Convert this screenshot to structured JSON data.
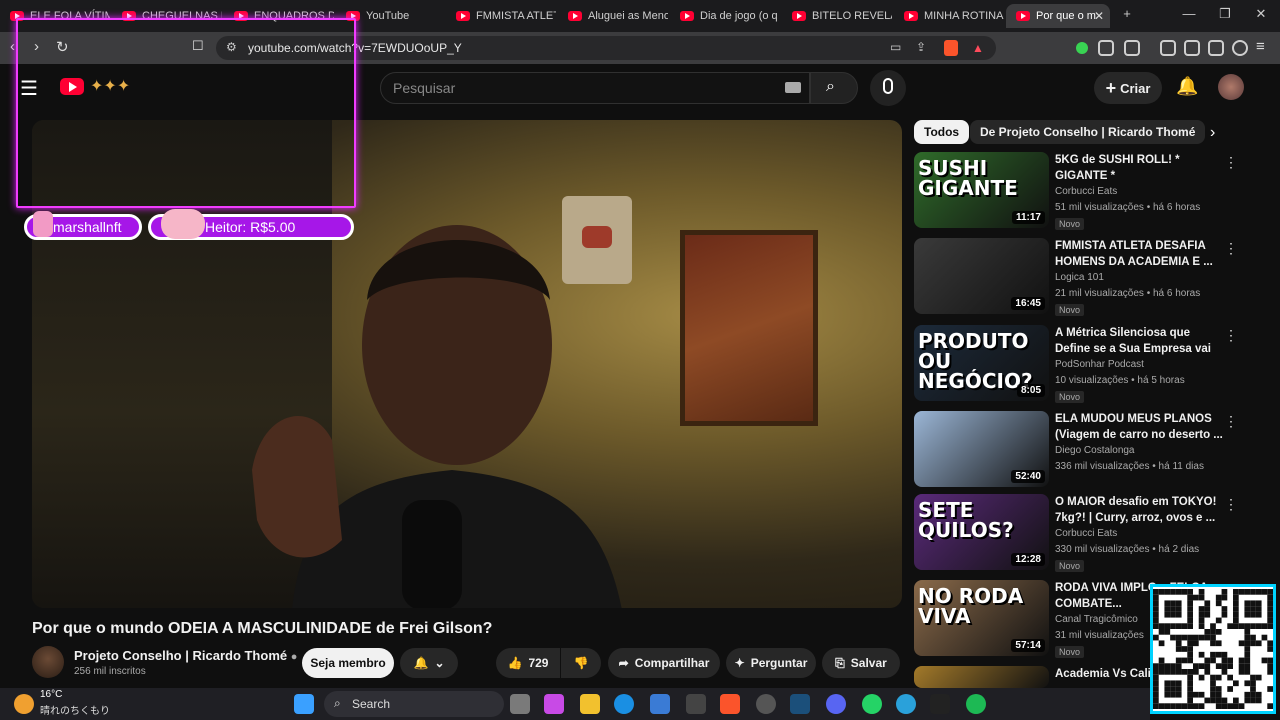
{
  "browser": {
    "tabs": [
      {
        "label": "ELE FOI A VÍTIMA"
      },
      {
        "label": "CHEGUEI NAS M..."
      },
      {
        "label": "ENQUADROS DE"
      },
      {
        "label": "YouTube"
      },
      {
        "label": "FMMISTA ATLETA"
      },
      {
        "label": "Aluguei as Meno"
      },
      {
        "label": "Dia de jogo (o q"
      },
      {
        "label": "BITELO REVELA C"
      },
      {
        "label": "MINHA ROTINA"
      },
      {
        "label": "Por que o m"
      }
    ],
    "url": "youtube.com/watch?v=7EWDUOoUP_Y"
  },
  "youtube": {
    "search_placeholder": "Pesquisar",
    "create_label": "Criar"
  },
  "overlay": {
    "pill1": "marshallnft",
    "pill2": "Heitor: R$5.00"
  },
  "video": {
    "title": "Por que o mundo ODEIA A MASCULINIDADE de Frei Gilson?",
    "channel": "Projeto Conselho | Ricardo Thomé",
    "subscribers": "256 mil inscritos",
    "member_label": "Seja membro",
    "likes": "729",
    "share_label": "Compartilhar",
    "ask_label": "Perguntar",
    "save_label": "Salvar"
  },
  "chips": [
    "Todos",
    "De Projeto Conselho | Ricardo Thomé"
  ],
  "recommendations": [
    {
      "title": "5KG de  SUSHI ROLL! * GIGANTE *",
      "channel": "Corbucci Eats",
      "views": "51 mil visualizações • há 6 horas",
      "badge": "Novo",
      "duration": "11:17",
      "thumb_text": "SUSHI GIGANTE",
      "thumb_color": "#2f6b2a"
    },
    {
      "title": "FMMISTA ATLETA DESAFIA HOMENS DA ACADEMIA E ...",
      "channel": "Logica 101",
      "views": "21 mil visualizações • há 6 horas",
      "badge": "Novo",
      "duration": "16:45",
      "thumb_text": "",
      "thumb_color": "#3a3a3a"
    },
    {
      "title": "A Métrica Silenciosa que Define se a Sua Empresa vai ESCALA...",
      "channel": "PodSonhar Podcast",
      "views": "10 visualizações • há 5 horas",
      "badge": "Novo",
      "duration": "8:05",
      "thumb_text": "PRODUTO OU NEGÓCIO?",
      "thumb_color": "#1c2a3a"
    },
    {
      "title": "ELA MUDOU MEUS PLANOS (Viagem de carro no deserto ...",
      "channel": "Diego Costalonga",
      "views": "336 mil visualizações • há 11 dias",
      "badge": "",
      "duration": "52:40",
      "thumb_text": "",
      "thumb_color": "#9bb6d6"
    },
    {
      "title": "O MAIOR desafio em TOKYO! 7kg?! | Curry, arroz, ovos e ...",
      "channel": "Corbucci Eats",
      "views": "330 mil visualizações • há 2 dias",
      "badge": "Novo",
      "duration": "12:28",
      "thumb_text": "SETE QUILOS?",
      "thumb_color": "#5a2a7a"
    },
    {
      "title": "RODA VIVA IMPLO... FELCA COMBATE...",
      "channel": "Canal Tragicômico",
      "views": "31 mil visualizações",
      "badge": "Novo",
      "duration": "57:14",
      "thumb_text": "NO RODA VIVA",
      "thumb_color": "#8a6a4a"
    },
    {
      "title": "Academia Vs Calis...",
      "channel": "",
      "views": "",
      "badge": "",
      "duration": "",
      "thumb_text": "",
      "thumb_color": "#a37a2a"
    }
  ],
  "taskbar": {
    "temperature": "16°C",
    "weather": "晴れのちくもり",
    "search_label": "Search"
  }
}
